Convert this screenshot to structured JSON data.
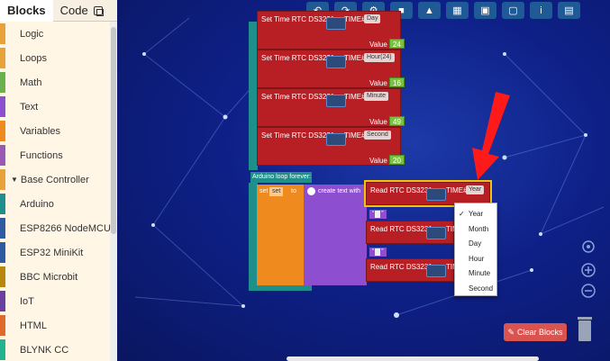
{
  "tabs": {
    "blocks": "Blocks",
    "code": "Code"
  },
  "sidebar": {
    "items": [
      {
        "label": "Logic",
        "color": "#e7a23a"
      },
      {
        "label": "Loops",
        "color": "#e7a23a"
      },
      {
        "label": "Math",
        "color": "#6ab04c"
      },
      {
        "label": "Text",
        "color": "#8d4fd0"
      },
      {
        "label": "Variables",
        "color": "#ef8a1e"
      },
      {
        "label": "Functions",
        "color": "#9b59b6"
      },
      {
        "label": "Base Controller",
        "color": "#e7a23a",
        "expanded": true
      },
      {
        "label": "Arduino",
        "color": "#1e8f8b"
      },
      {
        "label": "ESP8266 NodeMCU",
        "color": "#2d5aa0"
      },
      {
        "label": "ESP32 MiniKit",
        "color": "#2d5aa0"
      },
      {
        "label": "BBC Microbit",
        "color": "#b8860b"
      },
      {
        "label": "IoT",
        "color": "#6b3fa0"
      },
      {
        "label": "HTML",
        "color": "#e06a2a"
      },
      {
        "label": "BLYNK CC",
        "color": "#23b38e"
      }
    ]
  },
  "toolbar": {
    "icons": [
      "undo-icon",
      "redo-icon",
      "share-icon",
      "stop-icon",
      "upload-icon",
      "chart-icon",
      "save-icon",
      "folder-icon",
      "info-icon",
      "calculator-icon"
    ]
  },
  "blocks": {
    "setup": [
      {
        "label": "Set Time RTC DS3231",
        "time_label": "TIME#",
        "field": "Day",
        "value_label": "Value",
        "value": "24"
      },
      {
        "label": "Set Time RTC DS3231",
        "time_label": "TIME#",
        "field": "Hour(24)",
        "value_label": "Value",
        "value": "16"
      },
      {
        "label": "Set Time RTC DS3231",
        "time_label": "TIME#",
        "field": "Minute",
        "value_label": "Value",
        "value": "49"
      },
      {
        "label": "Set Time RTC DS3231",
        "time_label": "TIME#",
        "field": "Second",
        "value_label": "Value",
        "value": "20"
      }
    ],
    "loop_label": "Arduino loop forever:",
    "set_label": "set",
    "set_var": "set",
    "to_label": "to",
    "create_text_label": "create text with",
    "read_blocks": [
      {
        "label": "Read RTC DS3231",
        "time_label": "TIME#",
        "field": "Year"
      },
      {
        "label": "Read RTC DS3231",
        "time_label": "TIME"
      },
      {
        "label": "Read RTC DS3231",
        "time_label": "TIME"
      }
    ],
    "quote_open": "“",
    "quote_close": "”"
  },
  "dropdown": {
    "check": "✓",
    "options": [
      "Year",
      "Month",
      "Day",
      "Hour",
      "Minute",
      "Second"
    ],
    "selected": "Year"
  },
  "clear_button": "Clear Blocks"
}
